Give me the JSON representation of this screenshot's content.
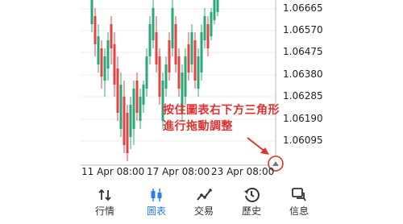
{
  "chart_data": {
    "type": "candlestick",
    "price_axis_labels": [
      "1.06665",
      "1.06570",
      "1.06475",
      "1.06380",
      "1.06285",
      "1.06190",
      "1.06095"
    ],
    "time_axis_labels": [
      "11 Apr 08:00",
      "17 Apr 08:00",
      "23 Apr 08:00"
    ],
    "colors": {
      "up": "#2aa876",
      "down": "#e04646"
    }
  },
  "annotation": {
    "line1": "按住圖表右下方三角形",
    "line2": "進行拖動調整",
    "color": "#e03030"
  },
  "tabbar": {
    "items": [
      {
        "label": "行情",
        "icon": "arrows-updown-icon"
      },
      {
        "label": "圖表",
        "icon": "candles-icon",
        "active": true
      },
      {
        "label": "交易",
        "icon": "trend-icon"
      },
      {
        "label": "歷史",
        "icon": "history-icon"
      },
      {
        "label": "信息",
        "icon": "chat-icon"
      }
    ],
    "active_color": "#2b7de9"
  }
}
